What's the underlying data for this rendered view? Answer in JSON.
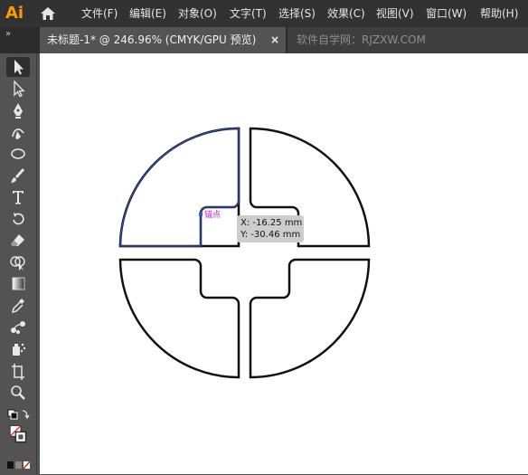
{
  "app": {
    "logo_text": "Ai"
  },
  "menu": [
    {
      "label": "文件(F)",
      "name": "menu-file"
    },
    {
      "label": "编辑(E)",
      "name": "menu-edit"
    },
    {
      "label": "对象(O)",
      "name": "menu-object"
    },
    {
      "label": "文字(T)",
      "name": "menu-type"
    },
    {
      "label": "选择(S)",
      "name": "menu-select"
    },
    {
      "label": "效果(C)",
      "name": "menu-effect"
    },
    {
      "label": "视图(V)",
      "name": "menu-view"
    },
    {
      "label": "窗口(W)",
      "name": "menu-window"
    },
    {
      "label": "帮助(H)",
      "name": "menu-help"
    }
  ],
  "tabs": {
    "collapse_label": "»",
    "active_title": "未标题-1* @ 246.96% (CMYK/GPU 预览)",
    "close_label": "×",
    "secondary_title": "软件自学网：RJZXW.COM"
  },
  "tools": [
    "selection-tool-icon",
    "direct-selection-tool-icon",
    "pen-tool-icon",
    "curvature-tool-icon",
    "ellipse-tool-icon",
    "paintbrush-tool-icon",
    "type-tool-icon",
    "rotate-tool-icon",
    "eraser-tool-icon",
    "shape-builder-tool-icon",
    "gradient-tool-icon",
    "eyedropper-tool-icon",
    "blend-tool-icon",
    "symbol-sprayer-tool-icon",
    "artboard-tool-icon",
    "zoom-tool-icon"
  ],
  "canvas": {
    "anchor_label": "锚点",
    "readout_x": "X: -16.25 mm",
    "readout_y": "Y: -30.46 mm"
  },
  "colors": {
    "brand": "#ff9a00",
    "selection": "#3a5bd0",
    "anchor_label": "#d020d0"
  }
}
